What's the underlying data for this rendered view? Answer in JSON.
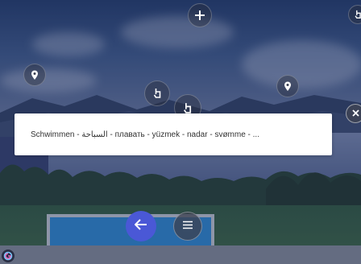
{
  "overlay_text": "Schwimmen - السباحة - плавать - yüzmek - nadar - svømme - ...",
  "icons": {
    "add": "plus-icon",
    "location": "map-pin-icon",
    "touch": "hand-pointer-icon",
    "close": "close-icon",
    "back": "arrow-left-icon",
    "menu": "hamburger-menu-icon",
    "logo": "app-logo-icon"
  },
  "colors": {
    "back_button": "#4a58d6",
    "textbox_bg": "#ffffff",
    "overlay_tint": "#26305f"
  }
}
